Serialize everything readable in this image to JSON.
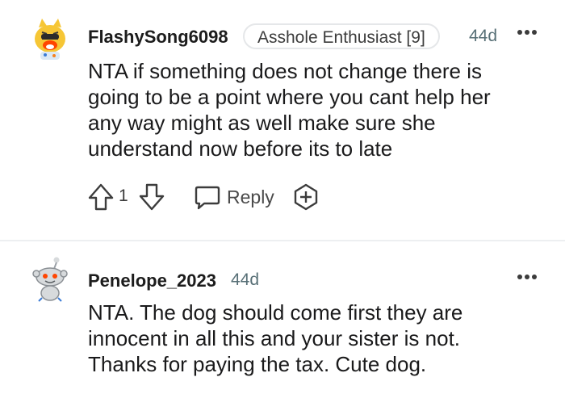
{
  "comments": [
    {
      "username": "FlashySong6098",
      "flair": "Asshole Enthusiast [9]",
      "timestamp": "44d",
      "body_lines": [
        "NTA if something does not change there is",
        "going to be a point where you cant help her",
        "any way might as well make sure she",
        "understand now before its to late"
      ],
      "score": "1",
      "reply_label": "Reply",
      "avatar_icon": "snoo-tiger-avatar",
      "more_icon": "more-options-icon"
    },
    {
      "username": "Penelope_2023",
      "timestamp": "44d",
      "body_lines": [
        "NTA. The dog should come first they are",
        "innocent in all this and your sister is not.",
        "Thanks for paying the tax. Cute dog."
      ],
      "avatar_icon": "snoo-default-avatar",
      "more_icon": "more-options-icon"
    }
  ],
  "colors": {
    "text": "#1a1a1b",
    "meta": "#576f76",
    "border": "#e5e7e9",
    "divider": "#edeff1"
  }
}
